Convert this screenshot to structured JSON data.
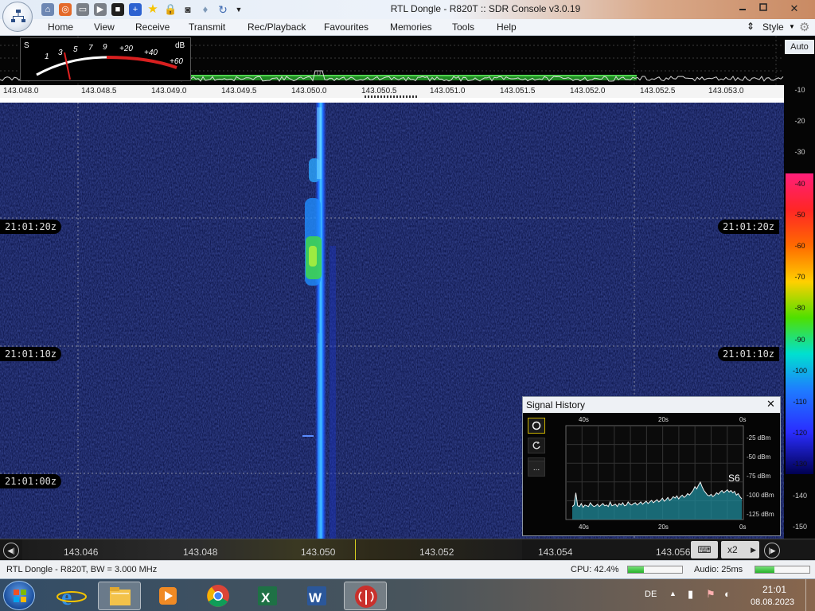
{
  "window": {
    "title": "RTL Dongle - R820T :: SDR Console v3.0.19",
    "minimize_icon": "minimize-icon",
    "maximize_icon": "maximize-icon",
    "close_symbol": "✕"
  },
  "menu": {
    "items": [
      "Home",
      "View",
      "Receive",
      "Transmit",
      "Rec/Playback",
      "Favourites",
      "Memories",
      "Tools",
      "Help"
    ],
    "style_label": "Style"
  },
  "smeter": {
    "s_label": "S",
    "db_label": "dB",
    "scale": [
      "1",
      "3",
      "5",
      "7",
      "9",
      "+20",
      "+40",
      "+60"
    ]
  },
  "spectrum": {
    "peak_marker": "0",
    "freq_ticks": [
      "143.048.0",
      "143.048.5",
      "143.049.0",
      "143.049.5",
      "143.050.0",
      "143.050.5",
      "143.051.0",
      "143.051.5",
      "143.052.0",
      "143.052.5",
      "143.053.0"
    ]
  },
  "db_scale": {
    "auto_label": "Auto",
    "labels": [
      "-10",
      "-20",
      "-30",
      "-40",
      "-50",
      "-60",
      "-70",
      "-80",
      "-90",
      "-100",
      "-110",
      "-120",
      "-130",
      "-140",
      "-150"
    ],
    "colors": [
      "#9a9a9a",
      "#9a9a9a",
      "#9a9a9a",
      "#ff2a6a",
      "#ff3030",
      "#ff6a1a",
      "#ffb000",
      "#e8e800",
      "#56e000",
      "#00d8d8",
      "#1e7cff",
      "#2a3cff",
      "#1a1aa0",
      "#9a9a9a",
      "#9a9a9a"
    ]
  },
  "waterfall": {
    "timestamps": [
      "21:01:20z",
      "21:01:10z",
      "21:01:00z"
    ]
  },
  "signal_history": {
    "title": "Signal History",
    "close_symbol": "✕",
    "time_top": [
      "40s",
      "20s",
      "0s"
    ],
    "time_bottom": [
      "40s",
      "20s",
      "0s"
    ],
    "levels": [
      "-25 dBm",
      "-50 dBm",
      "-75 dBm",
      "-100 dBm",
      "-125 dBm"
    ],
    "s_value": "S6",
    "btn_more": "...",
    "history_values": [
      -118,
      -116,
      -100,
      -117,
      -118,
      -114,
      -119,
      -116,
      -117,
      -118,
      -113,
      -116,
      -118,
      -117,
      -115,
      -118,
      -116,
      -114,
      -117,
      -116,
      -118,
      -112,
      -117,
      -116,
      -115,
      -118,
      -114,
      -116,
      -113,
      -117,
      -116,
      -112,
      -115,
      -116,
      -114,
      -113,
      -116,
      -114,
      -112,
      -115,
      -113,
      -111,
      -114,
      -112,
      -110,
      -113,
      -111,
      -109,
      -112,
      -110,
      -107,
      -111,
      -109,
      -106,
      -110,
      -108,
      -105,
      -107,
      -104,
      -108,
      -105,
      -103,
      -106,
      -104,
      -101,
      -103,
      -100,
      -97,
      -92,
      -95,
      -90,
      -86,
      -92,
      -97,
      -100,
      -103,
      -104,
      -102,
      -105,
      -103,
      -100,
      -102,
      -99,
      -97,
      -100,
      -98,
      -96,
      -99,
      -97,
      -100,
      -98,
      -103,
      -101,
      -105,
      -108
    ]
  },
  "tuning": {
    "labels": [
      "143.046",
      "143.048",
      "143.050",
      "143.052",
      "143.054",
      "143.056"
    ],
    "zoom": "x2"
  },
  "status": {
    "device": "RTL Dongle - R820T, BW = 3.000 MHz",
    "cpu": "CPU: 42.4%",
    "cpu_level": 0.3,
    "audio": "Audio: 25ms",
    "audio_level": 0.35
  },
  "taskbar": {
    "lang": "DE",
    "time": "21:01",
    "date": "08.08.2023"
  }
}
